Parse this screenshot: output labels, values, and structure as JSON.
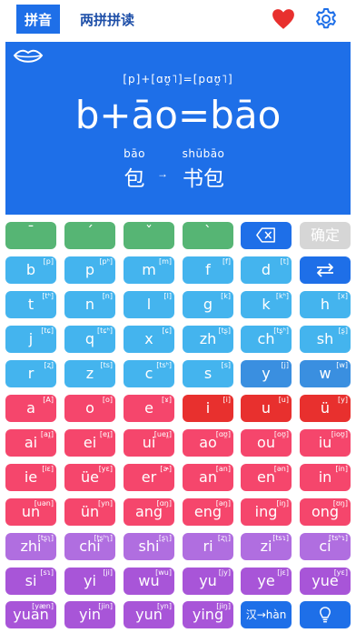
{
  "header": {
    "tab_pinyin": "拼音",
    "tab_two": "两拼拼读",
    "favorite_icon": "heart-icon",
    "settings_icon": "gear-icon",
    "accent": "#1e6fe8"
  },
  "display": {
    "ipa": "[p]+[ɑʊ̯˥]=[pɑʊ̯˥]",
    "formula": "b+āo=bāo",
    "example1_pinyin": "bāo",
    "example1_hanzi": "包",
    "arrow": "→",
    "example2_pinyin": "shūbāo",
    "example2_hanzi": "书包"
  },
  "tones": [
    "ˉ",
    "ˊ",
    "ˇ",
    "ˋ"
  ],
  "controls": {
    "backspace_icon": "backspace-icon",
    "confirm": "确定",
    "swap_icon": "swap-icon",
    "translate": "汉→hàn",
    "hint_icon": "lightbulb-icon"
  },
  "keys": [
    {
      "t": "b",
      "i": "[p]"
    },
    {
      "t": "p",
      "i": "[pʰ]"
    },
    {
      "t": "m",
      "i": "[m]"
    },
    {
      "t": "f",
      "i": "[f]"
    },
    {
      "t": "d",
      "i": "[t]"
    },
    {
      "t": "t",
      "i": "[tʰ]"
    },
    {
      "t": "n",
      "i": "[n]"
    },
    {
      "t": "l",
      "i": "[l]"
    },
    {
      "t": "g",
      "i": "[k]"
    },
    {
      "t": "k",
      "i": "[kʰ]"
    },
    {
      "t": "h",
      "i": "[x]"
    },
    {
      "t": "j",
      "i": "[tɕ]"
    },
    {
      "t": "q",
      "i": "[tɕʰ]"
    },
    {
      "t": "x",
      "i": "[ɕ]"
    },
    {
      "t": "zh",
      "i": "[tʂ]"
    },
    {
      "t": "ch",
      "i": "[tʂʰ]"
    },
    {
      "t": "sh",
      "i": "[ʂ]"
    },
    {
      "t": "r",
      "i": "[ʐ]"
    },
    {
      "t": "z",
      "i": "[ts]"
    },
    {
      "t": "c",
      "i": "[tsʰ]"
    },
    {
      "t": "s",
      "i": "[s]"
    },
    {
      "t": "y",
      "i": "[j]"
    },
    {
      "t": "w",
      "i": "[w]"
    },
    {
      "t": "a",
      "i": "[A]"
    },
    {
      "t": "o",
      "i": "[o]"
    },
    {
      "t": "e",
      "i": "[ɤ]"
    },
    {
      "t": "i",
      "i": "[i]"
    },
    {
      "t": "u",
      "i": "[u]"
    },
    {
      "t": "ü",
      "i": "[y]"
    },
    {
      "t": "ai",
      "i": "[aɪ̯]"
    },
    {
      "t": "ei",
      "i": "[eɪ̯]"
    },
    {
      "t": "ui",
      "i": "[ueɪ̯]"
    },
    {
      "t": "ao",
      "i": "[ɑʊ̯]"
    },
    {
      "t": "ou",
      "i": "[oʊ̯]"
    },
    {
      "t": "iu",
      "i": "[ioʊ̯]"
    },
    {
      "t": "ie",
      "i": "[iɛ]"
    },
    {
      "t": "üe",
      "i": "[yɛ]"
    },
    {
      "t": "er",
      "i": "[ɚ]"
    },
    {
      "t": "an",
      "i": "[an]"
    },
    {
      "t": "en",
      "i": "[ən]"
    },
    {
      "t": "in",
      "i": "[in]"
    },
    {
      "t": "un",
      "i": "[uən]"
    },
    {
      "t": "ün",
      "i": "[yn]"
    },
    {
      "t": "ang",
      "i": "[ɑŋ]"
    },
    {
      "t": "eng",
      "i": "[əŋ]"
    },
    {
      "t": "ing",
      "i": "[iŋ]"
    },
    {
      "t": "ong",
      "i": "[ʊŋ]"
    },
    {
      "t": "zhi",
      "i": "[tʂʅ]"
    },
    {
      "t": "chi",
      "i": "[tʂʰʅ]"
    },
    {
      "t": "shi",
      "i": "[ʂʅ]"
    },
    {
      "t": "ri",
      "i": "[ʐʅ]"
    },
    {
      "t": "zi",
      "i": "[tsɿ]"
    },
    {
      "t": "ci",
      "i": "[tsʰɿ]"
    },
    {
      "t": "si",
      "i": "[sɿ]"
    },
    {
      "t": "yi",
      "i": "[ji]"
    },
    {
      "t": "wu",
      "i": "[wu]"
    },
    {
      "t": "yu",
      "i": "[jy]"
    },
    {
      "t": "ye",
      "i": "[jɛ]"
    },
    {
      "t": "yue",
      "i": "[yɛ]"
    },
    {
      "t": "yuan",
      "i": "[yæn]"
    },
    {
      "t": "yin",
      "i": "[jin]"
    },
    {
      "t": "yun",
      "i": "[yn]"
    },
    {
      "t": "ying",
      "i": "[jiŋ]"
    }
  ]
}
